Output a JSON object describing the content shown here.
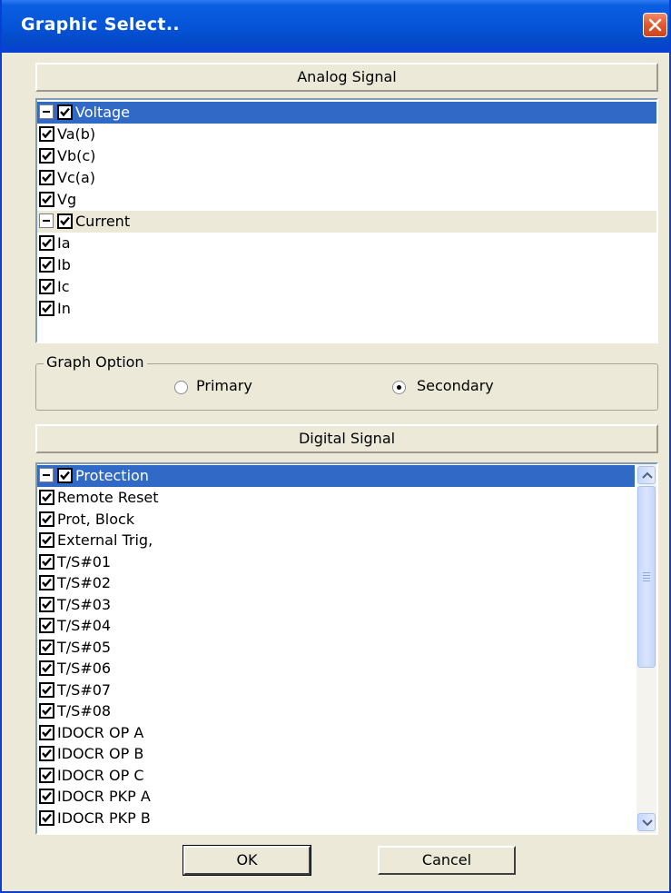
{
  "window": {
    "title": "Graphic Select..",
    "close_icon": "close-icon"
  },
  "analog": {
    "header": "Analog Signal",
    "groups": [
      {
        "label": "Voltage",
        "checked": true,
        "expanded": true,
        "items": [
          "Va(b)",
          "Vb(c)",
          "Vc(a)",
          "Vg"
        ]
      },
      {
        "label": "Current",
        "checked": true,
        "expanded": true,
        "items": [
          "Ia",
          "Ib",
          "Ic",
          "In"
        ]
      }
    ]
  },
  "graph_option": {
    "title": "Graph Option",
    "primary_label": "Primary",
    "secondary_label": "Secondary",
    "selected": "Secondary"
  },
  "digital": {
    "header": "Digital Signal",
    "group_label": "Protection",
    "items": [
      "Remote Reset",
      "Prot, Block",
      "External Trig,",
      "T/S#01",
      "T/S#02",
      "T/S#03",
      "T/S#04",
      "T/S#05",
      "T/S#06",
      "T/S#07",
      "T/S#08",
      "IDOCR OP A",
      "IDOCR OP B",
      "IDOCR OP C",
      "IDOCR PKP A",
      "IDOCR PKP B"
    ]
  },
  "buttons": {
    "ok": "OK",
    "cancel": "Cancel"
  },
  "colors": {
    "selection": "#3169c6",
    "title_bar": "#0554d8",
    "dialog_face": "#ece9d8"
  }
}
